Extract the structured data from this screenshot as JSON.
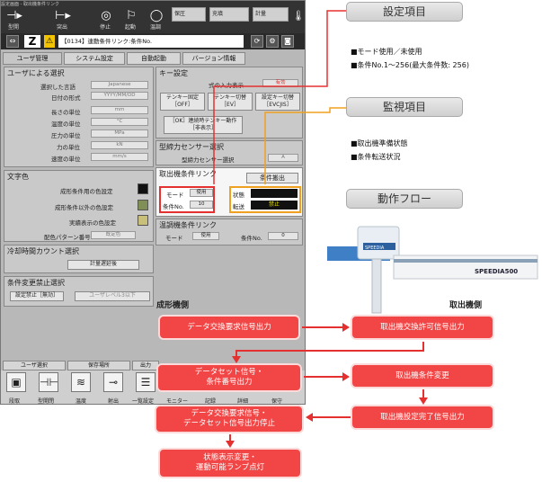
{
  "screen": {
    "title": "設定画面 - 取出機条件リンク",
    "topbar": {
      "items": [
        {
          "label": "型開",
          "icon": "mold-open-icon",
          "glyph": "⊣▸"
        },
        {
          "label": "突出",
          "icon": "eject-icon",
          "glyph": "⊢▸"
        },
        {
          "label": "停止",
          "icon": "stop-icon",
          "glyph": "◎"
        },
        {
          "label": "起動",
          "icon": "start-icon",
          "glyph": "⚐"
        },
        {
          "label": "温調",
          "icon": "temp-icon",
          "glyph": "◯"
        }
      ],
      "gauges": [
        "保圧",
        "充填",
        "計量"
      ]
    },
    "alarm_text": "【0134】連動条件リンク:条件No.",
    "main_tabs": [
      "ユーザ管理",
      "システム設定",
      "自動起動",
      "バージョン情報"
    ],
    "user_select": {
      "header": "ユーザによる選択",
      "rows": [
        {
          "label": "選択した言語",
          "value": "Japanese"
        },
        {
          "label": "日付の形式",
          "value": "YYYY/MM/DD"
        },
        {
          "label": "長さの単位",
          "value": "mm"
        },
        {
          "label": "温度の単位",
          "value": "°C"
        },
        {
          "label": "圧力の単位",
          "value": "MPa"
        },
        {
          "label": "力の単位",
          "value": "kN"
        },
        {
          "label": "速度の単位",
          "value": "mm/s"
        }
      ]
    },
    "text_color": {
      "header": "文字色",
      "rows": [
        {
          "label": "成形条件用の色設定",
          "color": "#111111"
        },
        {
          "label": "成形条件以外の色設定",
          "color": "#7f8f55"
        },
        {
          "label": "実績表示の色設定",
          "color": "#c8c07a"
        }
      ],
      "pattern_label": "配色パターン番号",
      "pattern_value": "既定色"
    },
    "cold_count": {
      "header": "冷却時間カウント選択",
      "value": "計量遅延後"
    },
    "condition_lock": {
      "header": "条件変更禁止選択",
      "btn1": "設定禁止［無効］",
      "btn2": "ユーザレベル3以下"
    },
    "key_settings": {
      "header": "キー設定",
      "key_label": "式の入力表示",
      "key_value": "有効",
      "buttons": [
        "テンキー固定［OFF］",
        "テンキー切替［EV］",
        "設定キー切替［EVCJIS］"
      ],
      "wide_button": "［OK］連続時テンキー動作［非表示］"
    },
    "mold_sensor": {
      "header": "型締力センサー選択",
      "label": "型締力センサー選択",
      "value": "A"
    },
    "ejector_link": {
      "header": "取出機条件リンク",
      "output_button": "条件搬出",
      "mode_label": "モード",
      "mode_value": "使用",
      "cond_no_label": "条件No.",
      "cond_no_value": "10",
      "status_label": "状態",
      "transfer_label": "転送",
      "transfer_value": "禁止"
    },
    "temp_link": {
      "header": "温調機条件リンク",
      "mode_label": "モード",
      "mode_value": "使用",
      "cond_no_label": "条件No.",
      "cond_no_value": "0"
    },
    "bottom_tabs": [
      "ユーザ選択",
      "保存場所",
      "出力"
    ],
    "bottom_icons": [
      {
        "label": "段取",
        "icon": "setup-icon",
        "glyph": "▣"
      },
      {
        "label": "型開閉",
        "icon": "mold-icon",
        "glyph": "⊣⊢"
      },
      {
        "label": "温度",
        "icon": "heater-icon",
        "glyph": "≋"
      },
      {
        "label": "射出",
        "icon": "injection-icon",
        "glyph": "⊸"
      },
      {
        "label": "一覧設定",
        "icon": "list-icon",
        "glyph": "☰"
      },
      {
        "label": "モニター",
        "icon": "monitor-icon",
        "glyph": "▭"
      },
      {
        "label": "記録",
        "icon": "record-icon",
        "glyph": "✎"
      },
      {
        "label": "詳細",
        "icon": "detail-icon",
        "glyph": "≡"
      },
      {
        "label": "保守",
        "icon": "maintenance-icon",
        "glyph": "⚙"
      }
    ]
  },
  "callouts": {
    "settings": {
      "title": "設定項目",
      "lines": [
        "■モード使用／未使用",
        "■条件No.1〜256(最大条件数: 256)"
      ]
    },
    "monitor": {
      "title": "監視項目",
      "lines": [
        "■取出機準備状態",
        "■条件転送状況"
      ]
    },
    "flow_title": "動作フロー"
  },
  "robot": {
    "brand": "SPEEDIA",
    "model": "SPEEDIA500"
  },
  "flow": {
    "left_label": "成形機側",
    "right_label": "取出機側",
    "left_steps": [
      "データ交換要求信号出力",
      "データセット信号・\n条件番号出力",
      "データ交換要求信号・\nデータセット信号出力停止",
      "状態表示変更・\n運動可能ランプ点灯"
    ],
    "right_steps": [
      "取出機交換許可信号出力",
      "取出機条件変更",
      "取出機設定完了信号出力"
    ]
  },
  "colors": {
    "accent_red": "#e53030",
    "accent_orange": "#f0a020",
    "flow_red": "#f24545"
  }
}
